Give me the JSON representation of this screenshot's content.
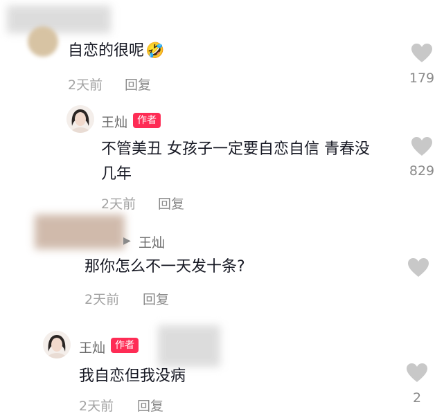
{
  "comments": [
    {
      "text": "自恋的很呢",
      "emoji": "🤣",
      "time": "2天前",
      "reply_label": "回复",
      "likes": "179"
    },
    {
      "author": "王灿",
      "badge": "作者",
      "text_line1": "不管美丑 女孩子一定要自恋自信 青春没",
      "text_line2": "几年",
      "time": "2天前",
      "reply_label": "回复",
      "likes": "829"
    },
    {
      "reply_to": "王灿",
      "text": "那你怎么不一天发十条?",
      "time": "2天前",
      "reply_label": "回复"
    },
    {
      "author": "王灿",
      "badge": "作者",
      "text": "我自恋但我没病",
      "time": "2天前",
      "reply_label": "回复",
      "likes": "2"
    }
  ],
  "icons": {
    "like": "heart-icon",
    "reply_arrow": "triangle-right-icon"
  },
  "colors": {
    "badge": "#fe2c55",
    "heart": "#c8c8c8",
    "meta": "#a3a3a3"
  }
}
